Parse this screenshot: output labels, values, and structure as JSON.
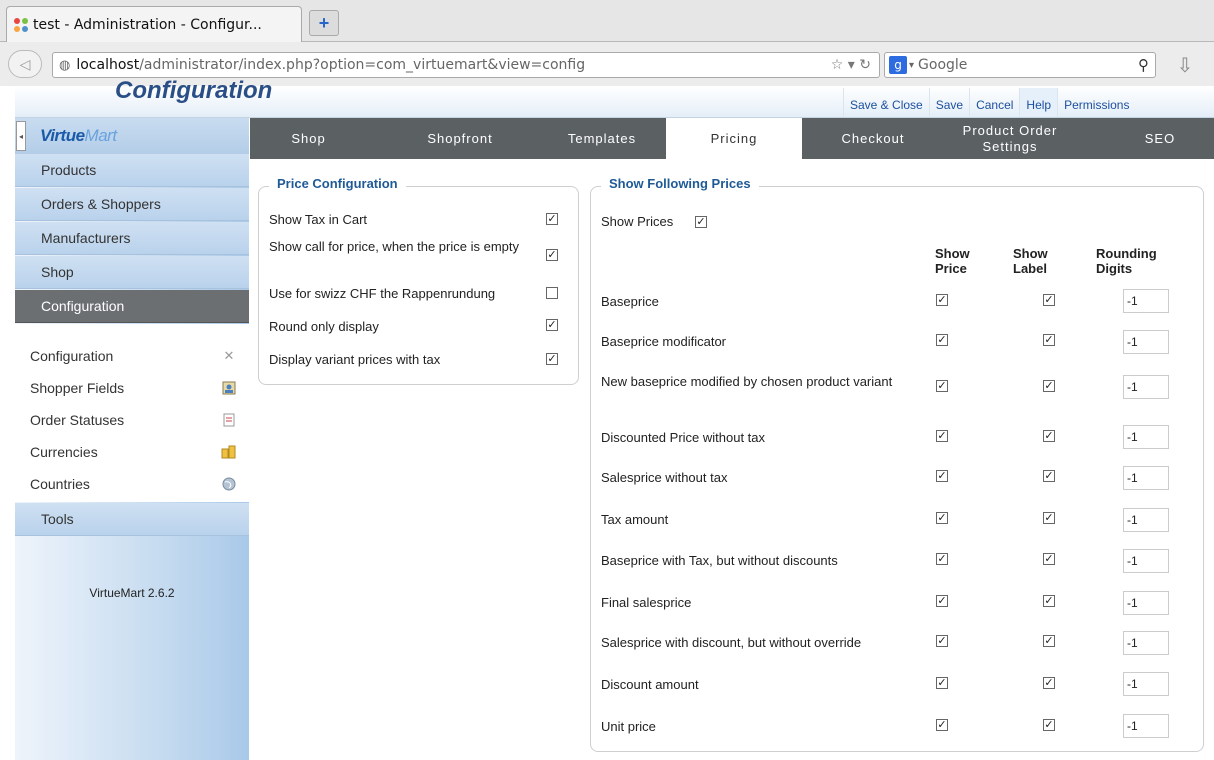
{
  "browser": {
    "tab_title": "test - Administration - Configur...",
    "new_tab": "+",
    "url_host": "localhost",
    "url_path": "/administrator/index.php?option=com_virtuemart&view=config",
    "search_placeholder": "Google"
  },
  "header": {
    "page_title": "Configuration",
    "toolbar": [
      "Save & Close",
      "Save",
      "Cancel",
      "Help",
      "Permissions"
    ]
  },
  "sidebar": {
    "logo": {
      "a": "Virtue",
      "b": "Mart"
    },
    "top_items": [
      "Products",
      "Orders & Shoppers",
      "Manufacturers",
      "Shop",
      "Configuration"
    ],
    "sub_items": [
      {
        "label": "Configuration",
        "icon": "tools-icon"
      },
      {
        "label": "Shopper Fields",
        "icon": "shopper-fields-icon"
      },
      {
        "label": "Order Statuses",
        "icon": "document-icon"
      },
      {
        "label": "Currencies",
        "icon": "coins-icon"
      },
      {
        "label": "Countries",
        "icon": "globe-icon"
      }
    ],
    "tools": "Tools",
    "version": "VirtueMart 2.6.2"
  },
  "tabs": [
    "Shop",
    "Shopfront",
    "Templates",
    "Pricing",
    "Checkout",
    "Product Order Settings",
    "SEO"
  ],
  "price_config": {
    "legend": "Price Configuration",
    "rows": [
      {
        "label": "Show Tax in Cart",
        "checked": true
      },
      {
        "label": "Show call for price, when the price is empty",
        "checked": true
      },
      {
        "label": "Use for swizz CHF the Rappenrundung",
        "checked": false
      },
      {
        "label": "Round only display",
        "checked": true
      },
      {
        "label": "Display variant prices with tax",
        "checked": true
      }
    ]
  },
  "show_prices": {
    "legend": "Show Following Prices",
    "show_prices_label": "Show Prices",
    "show_prices_checked": true,
    "col_show_price": "Show Price",
    "col_show_label": "Show Label",
    "col_rounding": "Rounding Digits",
    "rows": [
      {
        "label": "Baseprice",
        "show_price": true,
        "show_label": true,
        "rounding": "-1"
      },
      {
        "label": "Baseprice modificator",
        "show_price": true,
        "show_label": true,
        "rounding": "-1"
      },
      {
        "label": "New baseprice modified by chosen product variant",
        "show_price": true,
        "show_label": true,
        "rounding": "-1"
      },
      {
        "label": "Discounted Price without tax",
        "show_price": true,
        "show_label": true,
        "rounding": "-1"
      },
      {
        "label": "Salesprice without tax",
        "show_price": true,
        "show_label": true,
        "rounding": "-1"
      },
      {
        "label": "Tax amount",
        "show_price": true,
        "show_label": true,
        "rounding": "-1"
      },
      {
        "label": "Baseprice with Tax, but without discounts",
        "show_price": true,
        "show_label": true,
        "rounding": "-1"
      },
      {
        "label": "Final salesprice",
        "show_price": true,
        "show_label": true,
        "rounding": "-1"
      },
      {
        "label": "Salesprice with discount, but without override",
        "show_price": true,
        "show_label": true,
        "rounding": "-1"
      },
      {
        "label": "Discount amount",
        "show_price": true,
        "show_label": true,
        "rounding": "-1"
      },
      {
        "label": "Unit price",
        "show_price": true,
        "show_label": true,
        "rounding": "-1"
      }
    ]
  }
}
